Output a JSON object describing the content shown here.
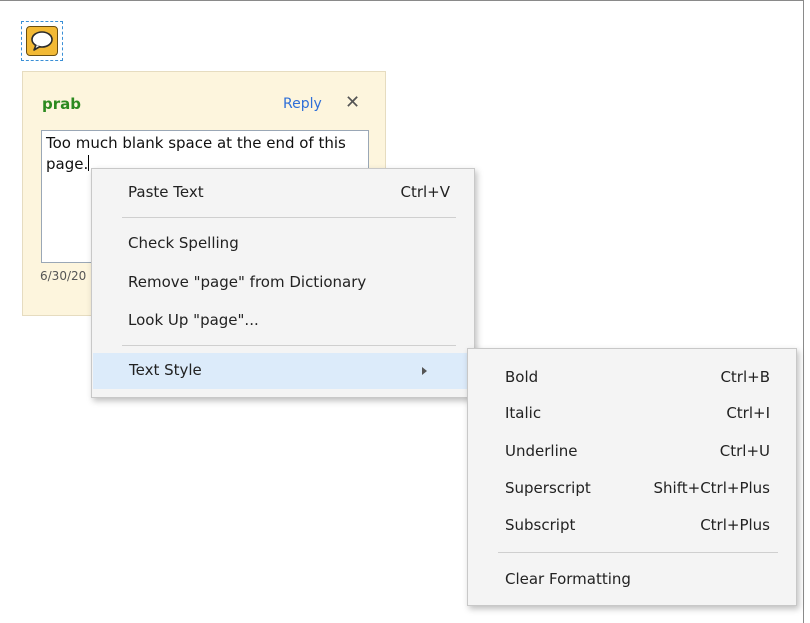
{
  "annotation": {
    "icon": "speech-bubble-icon",
    "author": "prab",
    "reply_label": "Reply",
    "close_symbol": "✕",
    "text_line1": "Too much blank space at the end of this",
    "text_line2": "page.",
    "date": "6/30/20"
  },
  "context_menu": {
    "paste": {
      "label": "Paste Text",
      "shortcut": "Ctrl+V"
    },
    "check_spelling": {
      "label": "Check Spelling"
    },
    "remove_dictionary": {
      "label": "Remove \"page\" from Dictionary"
    },
    "look_up": {
      "label": "Look Up \"page\"..."
    },
    "text_style": {
      "label": "Text Style"
    }
  },
  "submenu": {
    "bold": {
      "label": "Bold",
      "shortcut": "Ctrl+B"
    },
    "italic": {
      "label": "Italic",
      "shortcut": "Ctrl+I"
    },
    "underline": {
      "label": "Underline",
      "shortcut": "Ctrl+U"
    },
    "superscript": {
      "label": "Superscript",
      "shortcut": "Shift+Ctrl+Plus"
    },
    "subscript": {
      "label": "Subscript",
      "shortcut": "Ctrl+Plus"
    },
    "clear_formatting": {
      "label": "Clear Formatting"
    }
  },
  "colors": {
    "author": "#2c8a1f",
    "link": "#2f6fd8",
    "popup_bg": "#fdf5dd",
    "icon_fill": "#f2b935",
    "highlight": "#dcebfa"
  }
}
